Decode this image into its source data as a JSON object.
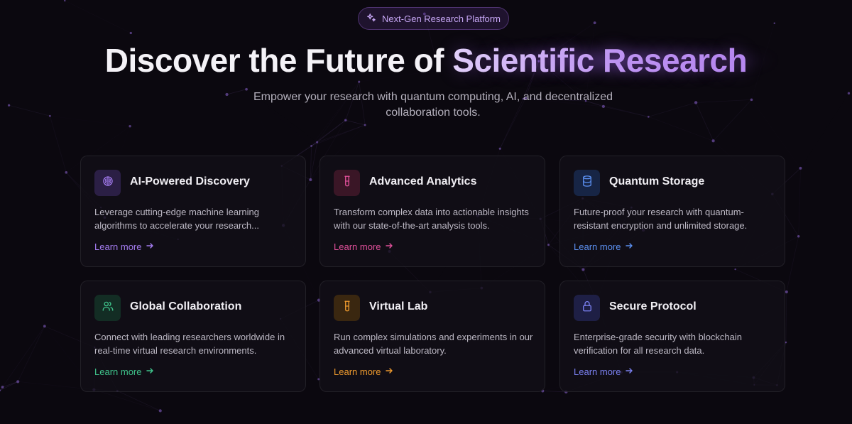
{
  "badge": {
    "label": "Next-Gen Research Platform",
    "icon": "sparkles-icon"
  },
  "hero": {
    "title_main": "Discover the Future of ",
    "title_accent": "Scientific Research",
    "subtitle": "Empower your research with quantum computing, AI, and decentralized collaboration tools."
  },
  "cards": [
    {
      "title": "AI-Powered Discovery",
      "description": "Leverage cutting-edge machine learning algorithms to accelerate your research...",
      "link": "Learn more",
      "icon": "brain-icon",
      "accent": "#a47cf0",
      "icon_bg": "#2b1f45"
    },
    {
      "title": "Advanced Analytics",
      "description": "Transform complex data into actionable insights with our state-of-the-art analysis tools.",
      "link": "Learn more",
      "icon": "beaker-icon",
      "accent": "#e0509a",
      "icon_bg": "#3a1626"
    },
    {
      "title": "Quantum Storage",
      "description": "Future-proof your research with quantum-resistant encryption and unlimited storage.",
      "link": "Learn more",
      "icon": "database-icon",
      "accent": "#5b8ff0",
      "icon_bg": "#172545"
    },
    {
      "title": "Global Collaboration",
      "description": "Connect with leading researchers worldwide in real-time virtual research environments.",
      "link": "Learn more",
      "icon": "users-icon",
      "accent": "#3fc38b",
      "icon_bg": "#132d24"
    },
    {
      "title": "Virtual Lab",
      "description": "Run complex simulations and experiments in our advanced virtual laboratory.",
      "link": "Learn more",
      "icon": "beaker-icon",
      "accent": "#ee9a2e",
      "icon_bg": "#3a2710"
    },
    {
      "title": "Secure Protocol",
      "description": "Enterprise-grade security with blockchain verification for all research data.",
      "link": "Learn more",
      "icon": "lock-icon",
      "accent": "#7a80f0",
      "icon_bg": "#1e1f45"
    }
  ]
}
